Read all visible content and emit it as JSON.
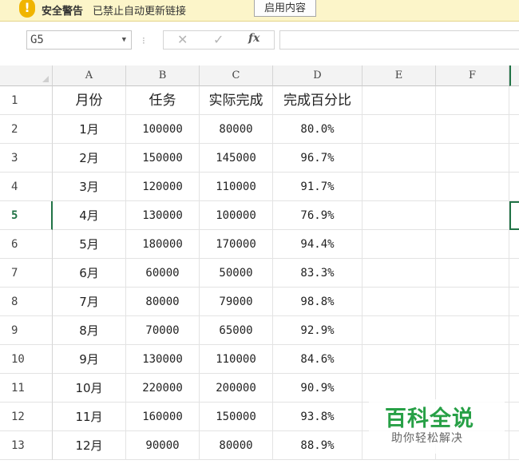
{
  "security_bar": {
    "title": "安全警告",
    "message": "已禁止自动更新链接",
    "enable_button": "启用内容",
    "icon": "warning-exclamation-icon"
  },
  "formula_bar": {
    "name_box": "G5",
    "formula": "",
    "icons": [
      "dropdown-arrow-icon",
      "more-dots-icon",
      "cancel-icon",
      "enter-icon",
      "fx-icon"
    ]
  },
  "grid": {
    "columns": [
      "A",
      "B",
      "C",
      "D",
      "E",
      "F"
    ],
    "selected_cell": "G5",
    "rows": [
      {
        "n": "1",
        "cells": [
          "月份",
          "任务",
          "实际完成",
          "完成百分比",
          "",
          ""
        ]
      },
      {
        "n": "2",
        "cells": [
          "1月",
          "100000",
          "80000",
          "80.0%",
          "",
          ""
        ]
      },
      {
        "n": "3",
        "cells": [
          "2月",
          "150000",
          "145000",
          "96.7%",
          "",
          ""
        ]
      },
      {
        "n": "4",
        "cells": [
          "3月",
          "120000",
          "110000",
          "91.7%",
          "",
          ""
        ]
      },
      {
        "n": "5",
        "cells": [
          "4月",
          "130000",
          "100000",
          "76.9%",
          "",
          ""
        ]
      },
      {
        "n": "6",
        "cells": [
          "5月",
          "180000",
          "170000",
          "94.4%",
          "",
          ""
        ]
      },
      {
        "n": "7",
        "cells": [
          "6月",
          "60000",
          "50000",
          "83.3%",
          "",
          ""
        ]
      },
      {
        "n": "8",
        "cells": [
          "7月",
          "80000",
          "79000",
          "98.8%",
          "",
          ""
        ]
      },
      {
        "n": "9",
        "cells": [
          "8月",
          "70000",
          "65000",
          "92.9%",
          "",
          ""
        ]
      },
      {
        "n": "10",
        "cells": [
          "9月",
          "130000",
          "110000",
          "84.6%",
          "",
          ""
        ]
      },
      {
        "n": "11",
        "cells": [
          "10月",
          "220000",
          "200000",
          "90.9%",
          "",
          ""
        ]
      },
      {
        "n": "12",
        "cells": [
          "11月",
          "160000",
          "150000",
          "93.8%",
          "",
          ""
        ]
      },
      {
        "n": "13",
        "cells": [
          "12月",
          "90000",
          "80000",
          "88.9%",
          "",
          ""
        ]
      }
    ]
  },
  "watermark": {
    "title": "百科全说",
    "subtitle": "助你轻松解决"
  },
  "colors": {
    "warning_bar_bg": "#fcf5c9",
    "selection_green": "#217346",
    "watermark_green": "#27a046"
  }
}
